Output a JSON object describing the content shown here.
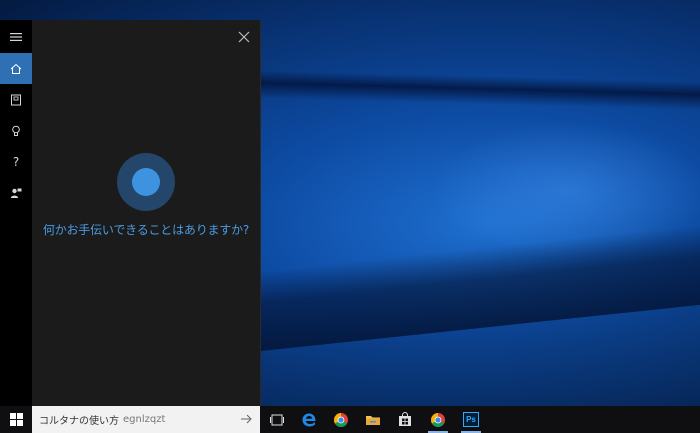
{
  "cortana": {
    "prompt": "何かお手伝いできることはありますか?",
    "rail": [
      {
        "id": "menu",
        "icon": "hamburger-icon"
      },
      {
        "id": "home",
        "icon": "home-icon",
        "active": true
      },
      {
        "id": "notebook",
        "icon": "notebook-icon"
      },
      {
        "id": "tips",
        "icon": "lightbulb-icon"
      },
      {
        "id": "help",
        "icon": "help-icon",
        "glyph": "?"
      },
      {
        "id": "feedback",
        "icon": "feedback-icon"
      }
    ],
    "close_icon": "close-icon"
  },
  "taskbar": {
    "search_label": "コルタナの使い方",
    "search_value": "egnlzqzt",
    "apps": [
      {
        "id": "task-view",
        "icon": "task-view-icon"
      },
      {
        "id": "edge",
        "icon": "edge-icon",
        "color": "#1e88e5"
      },
      {
        "id": "chrome",
        "icon": "chrome-icon"
      },
      {
        "id": "file-explorer",
        "icon": "folder-icon",
        "color": "#f5c24c"
      },
      {
        "id": "store",
        "icon": "store-icon"
      },
      {
        "id": "chrome-running",
        "icon": "chrome-icon",
        "running": true
      },
      {
        "id": "photoshop",
        "icon": "photoshop-icon",
        "glyph": "Ps",
        "color": "#31a8ff",
        "running": true
      }
    ]
  },
  "colors": {
    "accent": "#2f6fb3",
    "prompt": "#4a9be3",
    "orb_outer": "#23466a",
    "orb_inner": "#3d93e0"
  }
}
